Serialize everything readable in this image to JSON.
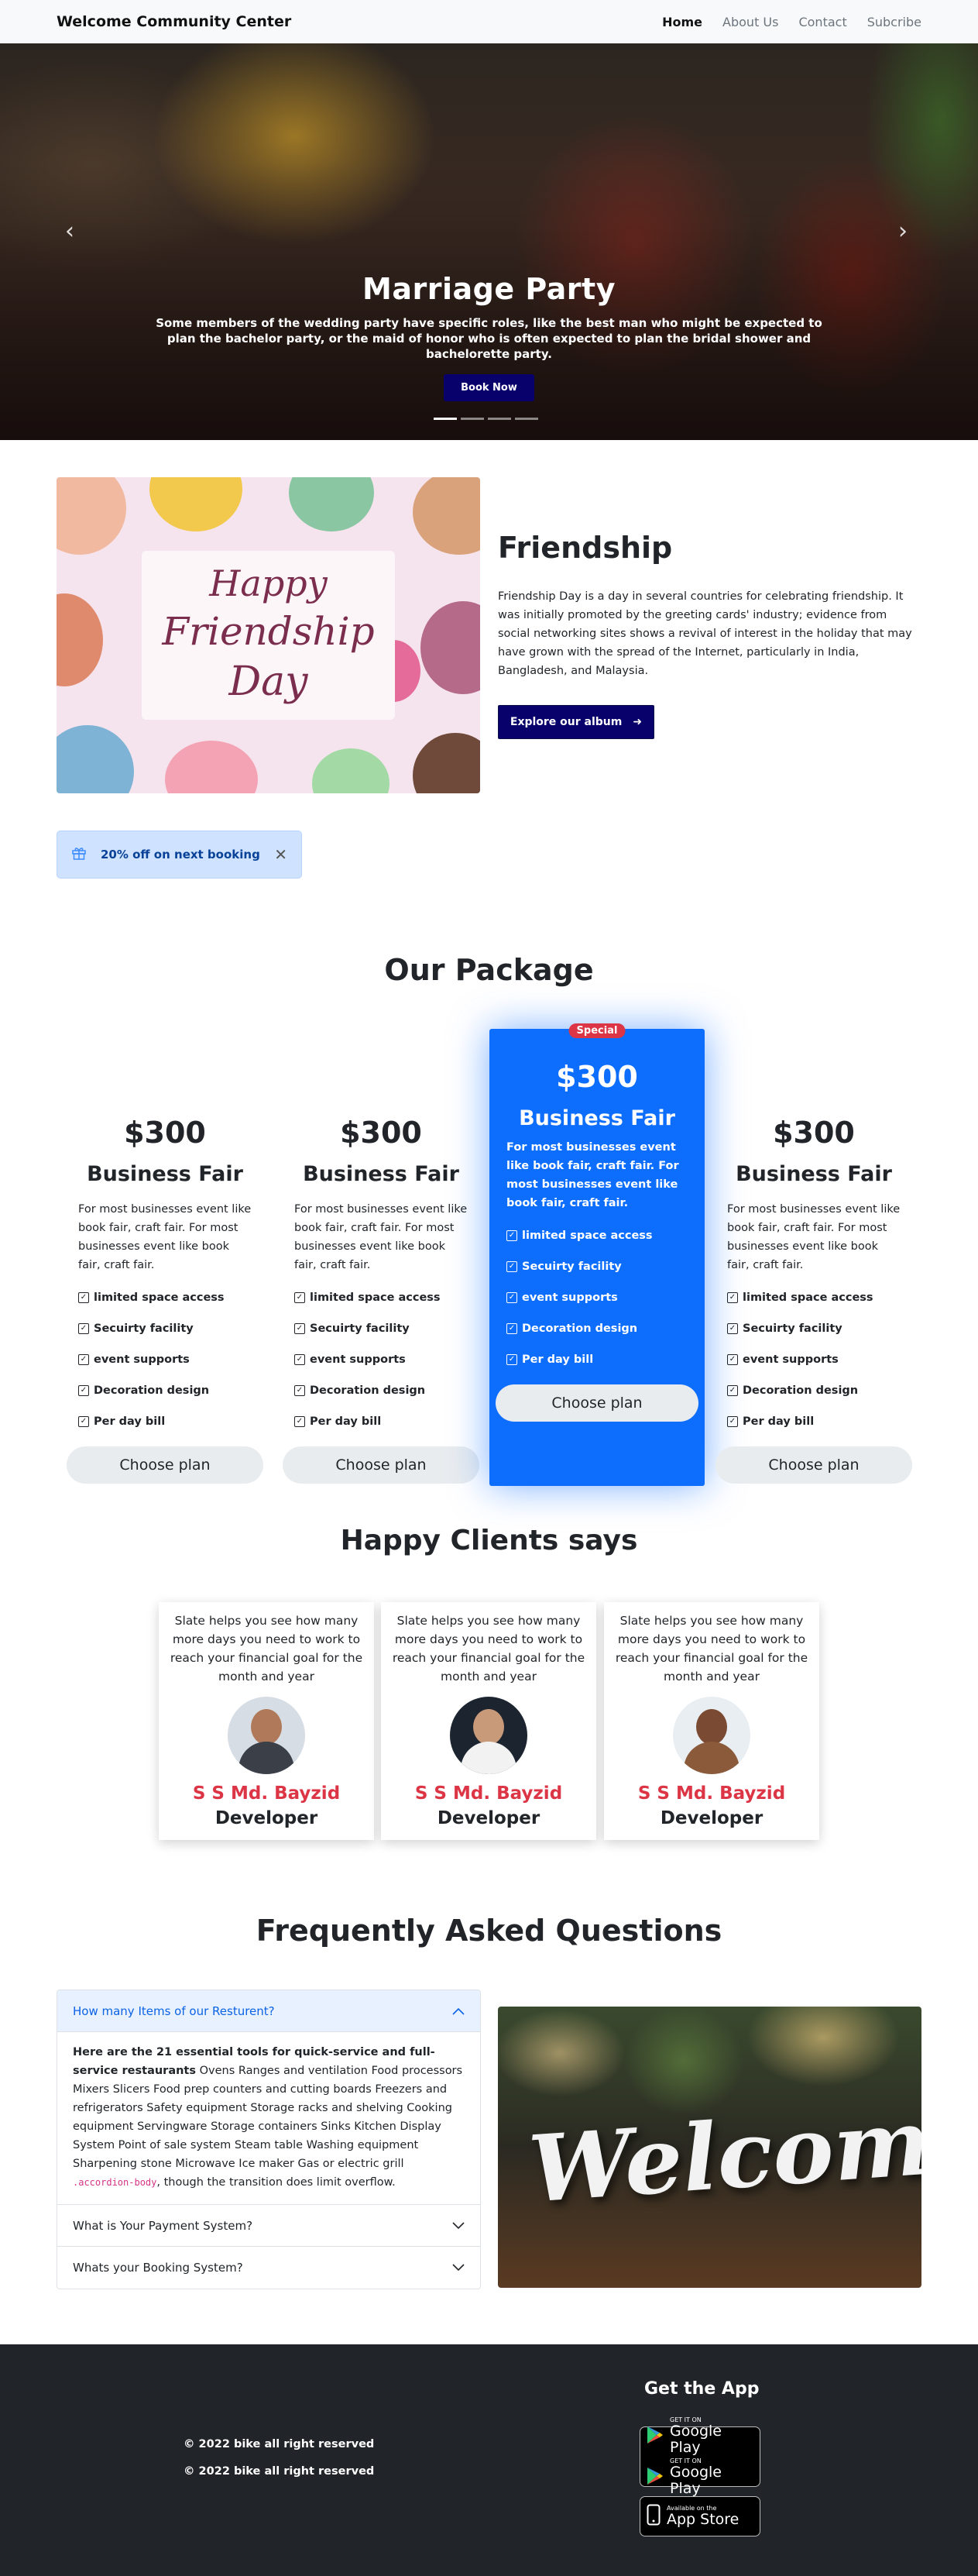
{
  "nav": {
    "brand": "Welcome Community Center",
    "links": [
      "Home",
      "About Us",
      "Contact",
      "Subcribe"
    ]
  },
  "hero": {
    "title": "Marriage Party",
    "text": "Some members of the wedding party have specific roles, like the best man who might be expected to plan the bachelor party, or the maid of honor who is often expected to plan the bridal shower and bachelorette party.",
    "button": "Book Now",
    "slide_count": 4,
    "active_slide": 1
  },
  "friendship": {
    "image_lines": [
      "Happy",
      "Friendship",
      "Day"
    ],
    "title": "Friendship",
    "text": "Friendship Day is a day in several countries for celebrating friendship. It was initially promoted by the greeting cards' industry; evidence from social networking sites shows a revival of interest in the holiday that may have grown with the spread of the Internet, particularly in India, Bangladesh, and Malaysia.",
    "button": "Explore our album",
    "button_icon": "arrow-right-icon"
  },
  "offer": {
    "icon": "gift-icon",
    "text": "20% off on next booking",
    "close_icon": "close-icon"
  },
  "packages": {
    "title": "Our Package",
    "special_badge": "Special",
    "items": [
      {
        "price": "$300",
        "name": "Business Fair",
        "desc": "For most businesses event like book fair, craft fair. For most businesses event like book fair, craft fair.",
        "features": [
          "limited space access",
          "Secuirty facility",
          "event supports",
          "Decoration design",
          "Per day bill"
        ],
        "button": "Choose plan"
      },
      {
        "price": "$300",
        "name": "Business Fair",
        "desc": "For most businesses event like book fair, craft fair. For most businesses event like book fair, craft fair.",
        "features": [
          "limited space access",
          "Secuirty facility",
          "event supports",
          "Decoration design",
          "Per day bill"
        ],
        "button": "Choose plan"
      },
      {
        "price": "$300",
        "name": "Business Fair",
        "desc": "For most businesses event like book fair, craft fair. For most businesses event like book fair, craft fair.",
        "features": [
          "limited space access",
          "Secuirty facility",
          "event supports",
          "Decoration design",
          "Per day bill"
        ],
        "button": "Choose plan"
      },
      {
        "price": "$300",
        "name": "Business Fair",
        "desc": "For most businesses event like book fair, craft fair. For most businesses event like book fair, craft fair.",
        "features": [
          "limited space access",
          "Secuirty facility",
          "event supports",
          "Decoration design",
          "Per day bill"
        ],
        "button": "Choose plan"
      }
    ]
  },
  "clients": {
    "title": "Happy Clients says",
    "items": [
      {
        "quote": "Slate helps you see how many more days you need to work to reach your financial goal for the month and year",
        "name": "S S Md. Bayzid",
        "role": "Developer"
      },
      {
        "quote": "Slate helps you see how many more days you need to work to reach your financial goal for the month and year",
        "name": "S S Md. Bayzid",
        "role": "Developer"
      },
      {
        "quote": "Slate helps you see how many more days you need to work to reach your financial goal for the month and year",
        "name": "S S Md. Bayzid",
        "role": "Developer"
      }
    ]
  },
  "faq": {
    "title": "Frequently Asked Questions",
    "items": [
      {
        "question": "How many Items of our Resturent?",
        "answer_bold": "Here are the 21 essential tools for quick-service and full-service restaurants",
        "answer": " Ovens Ranges and ventilation Food processors Mixers Slicers Food prep counters and cutting boards Freezers and refrigerators Safety equipment Storage racks and shelving Cooking equipment Servingware Storage containers Sinks Kitchen Display System Point of sale system Steam table Washing equipment Sharpening stone Microwave Ice maker Gas or electric grill ",
        "answer_code": ".accordion-body",
        "answer_tail": ", though the transition does limit overflow."
      },
      {
        "question": "What is Your Payment System?"
      },
      {
        "question": "Whats your Booking System?"
      }
    ],
    "image_text": "Welcome"
  },
  "footer": {
    "copyright_1": "© 2022 bike all right reserved",
    "copyright_2": "© 2022 bike all right reserved",
    "get_app": "Get the App",
    "google_small": "GET IT ON",
    "google_big": "Google Play",
    "apple_small": "Available on the",
    "apple_big": "App Store"
  }
}
